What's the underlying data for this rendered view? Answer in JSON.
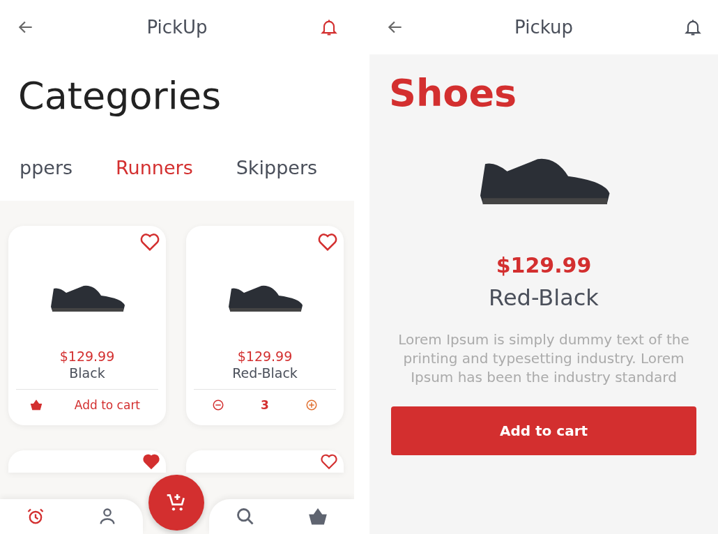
{
  "list_screen": {
    "header": {
      "title": "PickUp"
    },
    "heading": "Categories",
    "tabs": [
      {
        "label": "ppers",
        "selected": false
      },
      {
        "label": "Runners",
        "selected": true
      },
      {
        "label": "Skippers",
        "selected": false
      }
    ],
    "products": [
      {
        "favorite": false,
        "price": "$129.99",
        "name": "Black",
        "kind": "add",
        "cart_label": "Add to cart"
      },
      {
        "favorite": false,
        "price": "$129.99",
        "name": "Red-Black",
        "kind": "qty",
        "quantity": "3"
      },
      {
        "favorite": true,
        "kind": "partial"
      },
      {
        "favorite": false,
        "kind": "partial"
      }
    ],
    "bottom_nav": [
      {
        "kind": "alarm",
        "selected": true
      },
      {
        "kind": "person",
        "selected": false
      },
      {
        "kind": "search",
        "selected": false
      },
      {
        "kind": "basket",
        "selected": false
      }
    ]
  },
  "detail_screen": {
    "header": {
      "title": "Pickup"
    },
    "category": "Shoes",
    "price": "$129.99",
    "name": "Red-Black",
    "description": "Lorem Ipsum is simply dummy text of the printing and typesetting industry. Lorem Ipsum has been the industry standard",
    "button": "Add to cart"
  }
}
